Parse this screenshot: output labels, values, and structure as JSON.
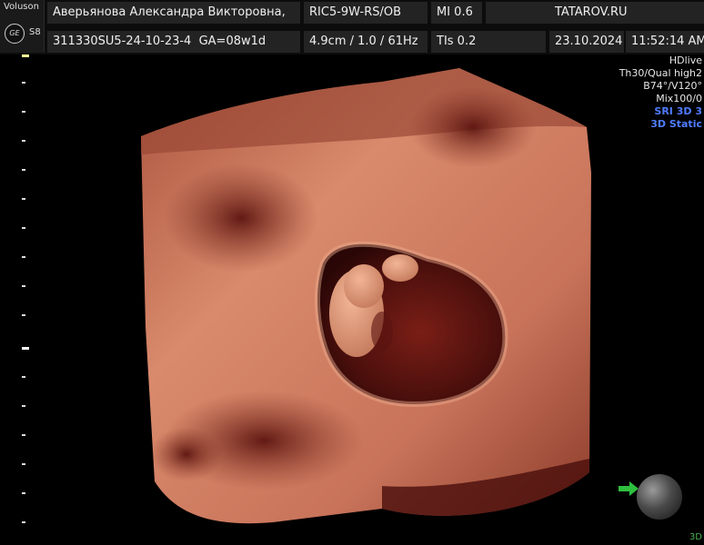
{
  "header": {
    "brand": "Voluson",
    "model": "S8",
    "logo_text": "GE",
    "patient_name": "Аверьянова Александра Викторовна,",
    "probe": "RIC5-9W-RS/OB",
    "mi": "MI 0.6",
    "site": "TATAROV.RU",
    "exam_id": "311330SU5-24-10-23-4",
    "ga": "GA=08w1d",
    "depth_freq": "4.9cm / 1.0 / 61Hz",
    "tis": "TIs 0.2",
    "date": "23.10.2024",
    "time": "11:52:14 AM"
  },
  "right_panel": {
    "lines": [
      "HDlive",
      "Th30/Qual high2",
      "B74°/V120°",
      "Mix100/0"
    ],
    "blue_lines": [
      "SRI 3D 3",
      "3D Static"
    ]
  },
  "corner_label": "3D",
  "colors": {
    "background": "#000000",
    "header_cell": "#232323",
    "tissue": "#c8735a",
    "cavity": "#5a1410",
    "blue_text": "#4f7cff",
    "arrow": "#2fbf3f"
  },
  "icons": {
    "logo": "ge-logo-icon",
    "orientation": "orientation-sphere-icon",
    "arrow": "green-arrow-icon"
  }
}
